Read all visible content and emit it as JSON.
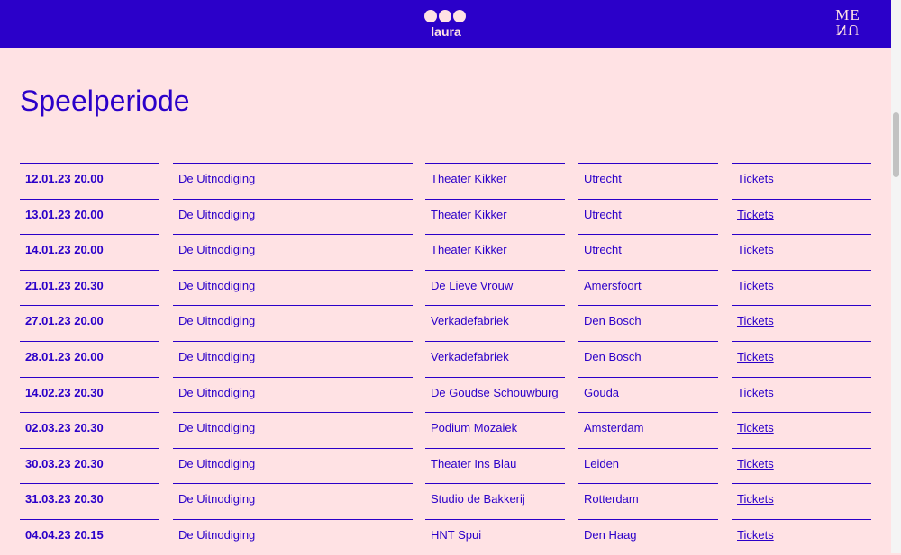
{
  "header": {
    "logo_text": "laura",
    "menu_line1": "ME",
    "menu_line2": "NU"
  },
  "page": {
    "title": "Speelperiode"
  },
  "performances": [
    {
      "date": "12.01.23 20.00",
      "title": "De Uitnodiging",
      "venue": "Theater Kikker",
      "city": "Utrecht",
      "tickets": "Tickets"
    },
    {
      "date": "13.01.23 20.00",
      "title": "De Uitnodiging",
      "venue": "Theater Kikker",
      "city": "Utrecht",
      "tickets": "Tickets"
    },
    {
      "date": "14.01.23 20.00",
      "title": "De Uitnodiging",
      "venue": "Theater Kikker",
      "city": "Utrecht",
      "tickets": "Tickets"
    },
    {
      "date": "21.01.23 20.30",
      "title": "De Uitnodiging",
      "venue": "De Lieve Vrouw",
      "city": "Amersfoort",
      "tickets": "Tickets"
    },
    {
      "date": "27.01.23 20.00",
      "title": "De Uitnodiging",
      "venue": "Verkadefabriek",
      "city": "Den Bosch",
      "tickets": "Tickets"
    },
    {
      "date": "28.01.23 20.00",
      "title": "De Uitnodiging",
      "venue": "Verkadefabriek",
      "city": "Den Bosch",
      "tickets": "Tickets"
    },
    {
      "date": "14.02.23 20.30",
      "title": "De Uitnodiging",
      "venue": "De Goudse Schouwburg",
      "city": "Gouda",
      "tickets": "Tickets"
    },
    {
      "date": "02.03.23 20.30",
      "title": "De Uitnodiging",
      "venue": "Podium Mozaiek",
      "city": "Amsterdam",
      "tickets": "Tickets"
    },
    {
      "date": "30.03.23 20.30",
      "title": "De Uitnodiging",
      "venue": "Theater Ins Blau",
      "city": "Leiden",
      "tickets": "Tickets"
    },
    {
      "date": "31.03.23 20.30",
      "title": "De Uitnodiging",
      "venue": "Studio de Bakkerij",
      "city": "Rotterdam",
      "tickets": "Tickets"
    },
    {
      "date": "04.04.23 20.15",
      "title": "De Uitnodiging",
      "venue": "HNT Spui",
      "city": "Den Haag",
      "tickets": "Tickets"
    }
  ],
  "colors": {
    "accent": "#2b00c9",
    "background": "#ffe2e4"
  }
}
